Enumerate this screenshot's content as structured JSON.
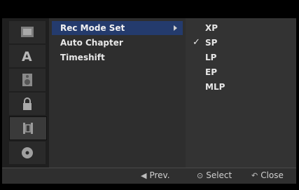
{
  "sidebar": {
    "items": [
      {
        "icon": "disc-tray-icon"
      },
      {
        "icon": "language-a-icon"
      },
      {
        "icon": "speaker-icon"
      },
      {
        "icon": "lock-icon"
      },
      {
        "icon": "film-strip-icon"
      },
      {
        "icon": "dvd-disc-icon"
      }
    ],
    "active_index": 4
  },
  "menu": {
    "items": [
      {
        "label": "Rec Mode Set",
        "selected": true
      },
      {
        "label": "Auto Chapter",
        "selected": false
      },
      {
        "label": "Timeshift",
        "selected": false
      }
    ]
  },
  "options": {
    "items": [
      {
        "label": "XP",
        "checked": false
      },
      {
        "label": "SP",
        "checked": true
      },
      {
        "label": "LP",
        "checked": false
      },
      {
        "label": "EP",
        "checked": false
      },
      {
        "label": "MLP",
        "checked": false
      }
    ],
    "check_mark": "✓"
  },
  "footer": {
    "prev_label": "Prev.",
    "prev_icon": "◀",
    "select_label": "Select",
    "select_icon": "⊙",
    "close_label": "Close",
    "close_icon": "↶"
  },
  "colors": {
    "highlight": "#243b6d",
    "background": "#1f1f1f"
  }
}
